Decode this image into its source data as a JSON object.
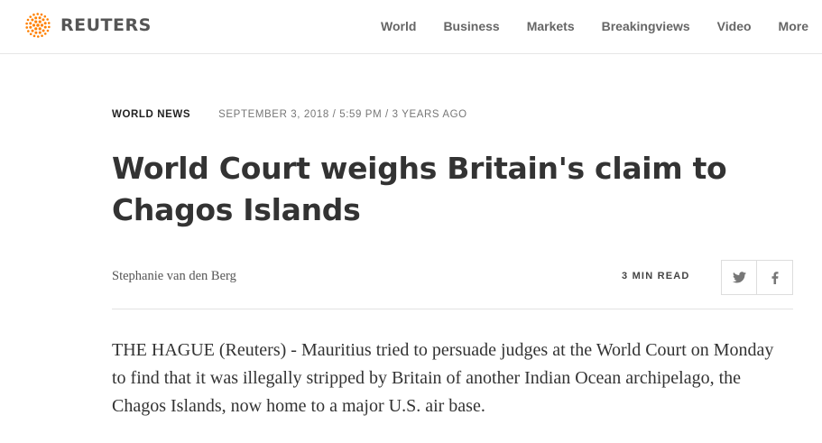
{
  "header": {
    "logo_text": "REUTERS",
    "nav": [
      "World",
      "Business",
      "Markets",
      "Breakingviews",
      "Video",
      "More"
    ]
  },
  "article": {
    "section": "WORLD NEWS",
    "dateline": "SEPTEMBER 3, 2018 / 5:59 PM / 3 YEARS AGO",
    "headline": "World Court weighs Britain's claim to Chagos Islands",
    "author": "Stephanie van den Berg",
    "read_time": "3 MIN READ",
    "share": {
      "twitter_icon": "twitter-icon",
      "facebook_icon": "facebook-icon"
    },
    "body": "THE HAGUE (Reuters) - Mauritius tried to persuade judges at the World Court on Monday to find that it was illegally stripped by Britain of another Indian Ocean archipelago, the Chagos Islands, now home to a major U.S. air base."
  },
  "colors": {
    "logo_orange": "#ff8000",
    "text": "#333333",
    "nav": "#666666"
  }
}
